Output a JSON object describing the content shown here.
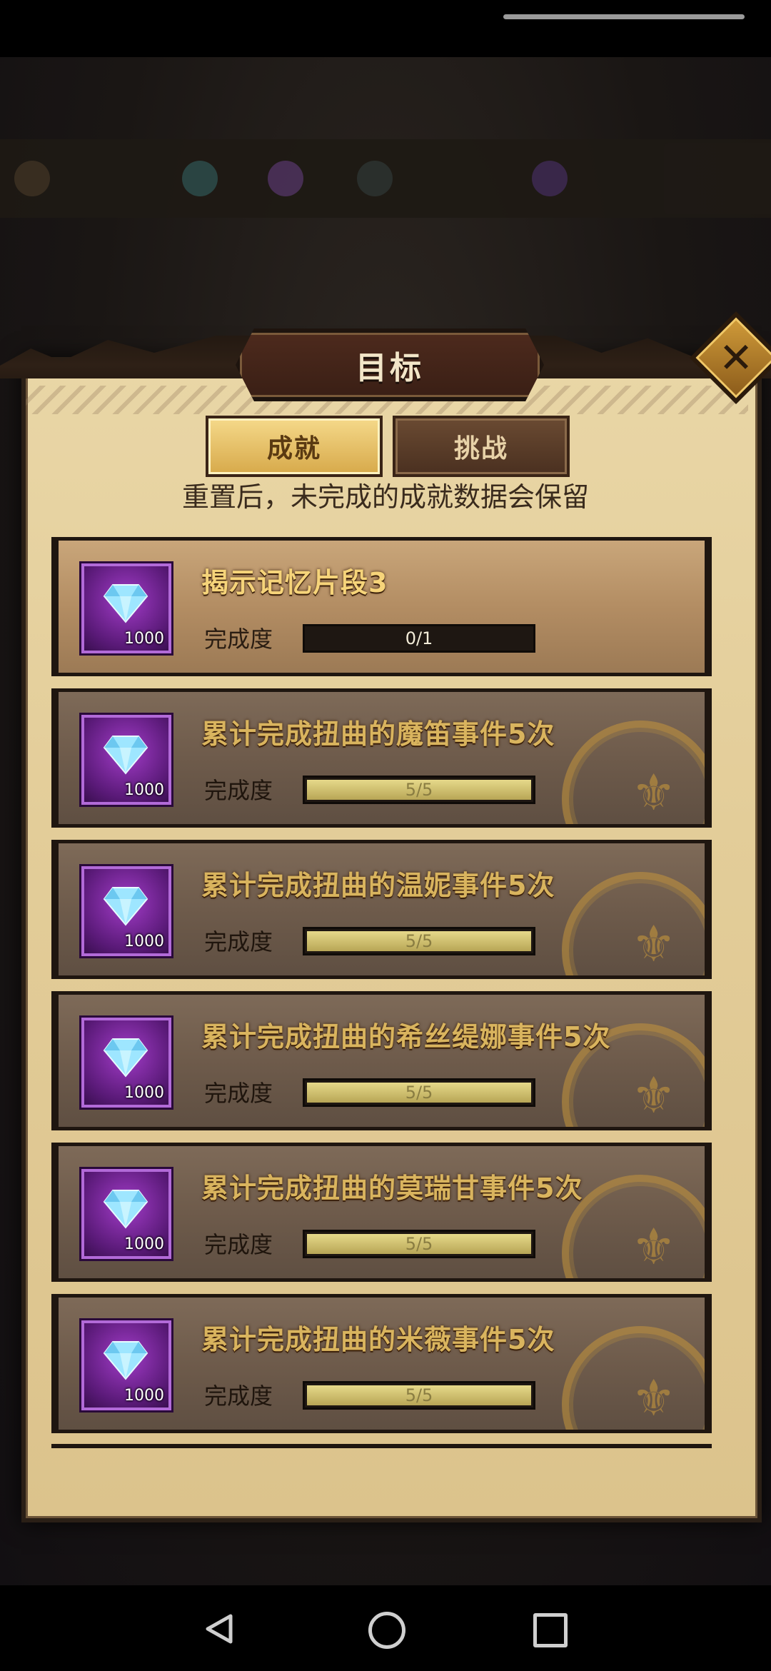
{
  "dialog": {
    "title": "目标",
    "tabs": [
      {
        "label": "成就",
        "active": true
      },
      {
        "label": "挑战",
        "active": false
      }
    ],
    "notice": "重置后，未完成的成就数据会保留",
    "progress_label": "完成度",
    "achievements": [
      {
        "title": "揭示记忆片段3",
        "reward_qty": "1000",
        "progress": "0/1",
        "fraction": 0,
        "completed": false
      },
      {
        "title": "累计完成扭曲的魔笛事件5次",
        "reward_qty": "1000",
        "progress": "5/5",
        "fraction": 1,
        "completed": true
      },
      {
        "title": "累计完成扭曲的温妮事件5次",
        "reward_qty": "1000",
        "progress": "5/5",
        "fraction": 1,
        "completed": true
      },
      {
        "title": "累计完成扭曲的希丝缇娜事件5次",
        "reward_qty": "1000",
        "progress": "5/5",
        "fraction": 1,
        "completed": true
      },
      {
        "title": "累计完成扭曲的莫瑞甘事件5次",
        "reward_qty": "1000",
        "progress": "5/5",
        "fraction": 1,
        "completed": true
      },
      {
        "title": "累计完成扭曲的米薇事件5次",
        "reward_qty": "1000",
        "progress": "5/5",
        "fraction": 1,
        "completed": true
      }
    ]
  },
  "icons": {
    "close": "close-icon",
    "reward": "diamond-icon",
    "stamp": "completed-seal-icon",
    "nav": [
      "back-icon",
      "home-icon",
      "recents-icon"
    ]
  },
  "colors": {
    "parchment": "#e3cd99",
    "gold_text": "#f6d47a",
    "reward_purple": "#7a2aa0"
  }
}
